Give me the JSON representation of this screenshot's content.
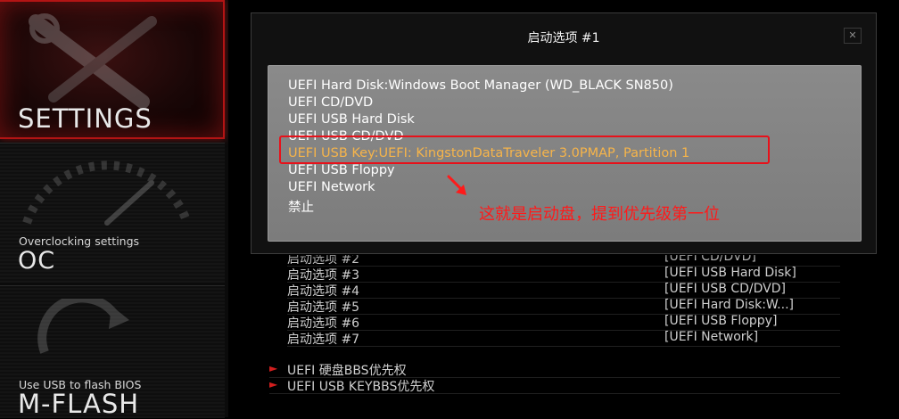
{
  "sidebar": {
    "settings": {
      "label": "SETTINGS"
    },
    "oc": {
      "caption": "Overclocking settings",
      "label": "OC"
    },
    "mflash": {
      "caption": "Use USB to flash BIOS",
      "label": "M-FLASH"
    }
  },
  "dialog": {
    "title": "启动选项 #1",
    "close": "✕",
    "options": [
      "UEFI Hard Disk:Windows Boot Manager (WD_BLACK SN850)",
      "UEFI CD/DVD",
      "UEFI USB Hard Disk",
      "UEFI USB CD/DVD",
      "UEFI USB Key:UEFI: KingstonDataTraveler 3.0PMAP, Partition 1",
      "UEFI USB Floppy",
      "UEFI Network",
      "禁止"
    ],
    "selected_index": 4,
    "annotation": "这就是启动盘，提到优先级第一位"
  },
  "boot_options": [
    {
      "label": "启动选项 #2",
      "value": "[UEFI CD/DVD]"
    },
    {
      "label": "启动选项 #3",
      "value": "[UEFI USB Hard Disk]"
    },
    {
      "label": "启动选项 #4",
      "value": "[UEFI USB CD/DVD]"
    },
    {
      "label": "启动选项 #5",
      "value": "[UEFI Hard Disk:W...]"
    },
    {
      "label": "启动选项 #6",
      "value": "[UEFI USB Floppy]"
    },
    {
      "label": "启动选项 #7",
      "value": "[UEFI Network]"
    }
  ],
  "submenus": [
    {
      "label": "UEFI 硬盘BBS优先权"
    },
    {
      "label": "UEFI USB KEYBBS优先权"
    }
  ],
  "colors": {
    "accent_red": "#d21e1e",
    "selected_option": "#f6b44a",
    "annotation": "#ff1a1a"
  }
}
